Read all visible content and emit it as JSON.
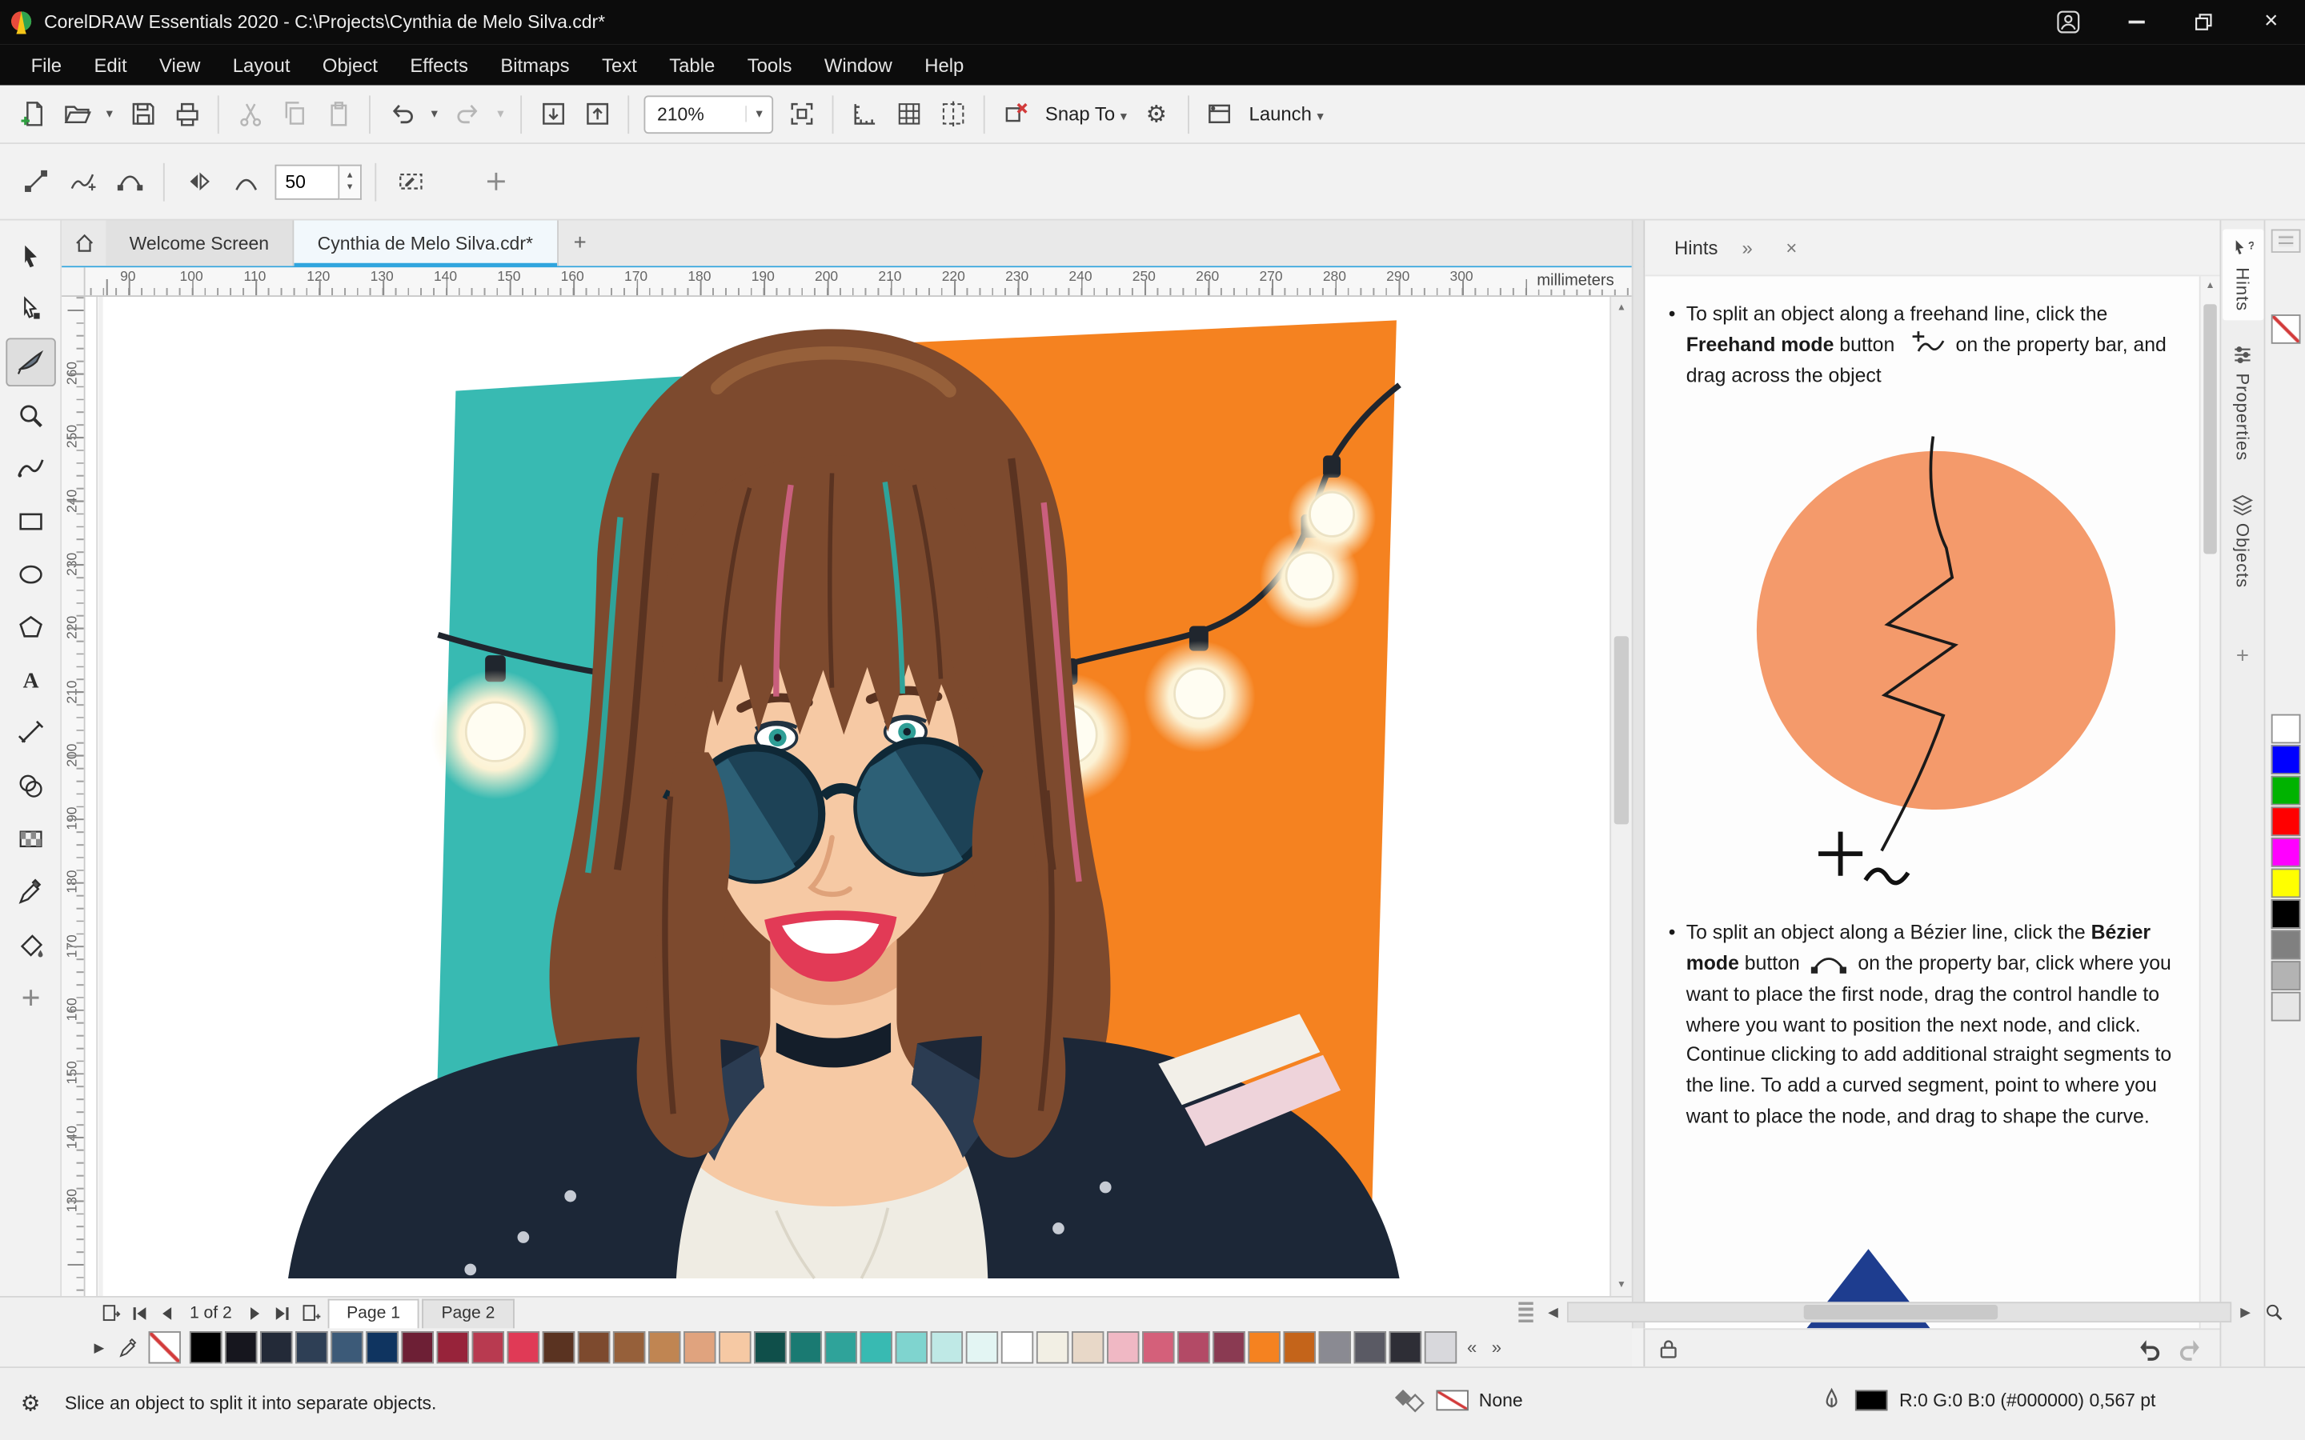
{
  "titlebar": {
    "title": "CorelDRAW Essentials 2020 - C:\\Projects\\Cynthia de Melo Silva.cdr*"
  },
  "menubar": {
    "items": [
      "File",
      "Edit",
      "View",
      "Layout",
      "Object",
      "Effects",
      "Bitmaps",
      "Text",
      "Table",
      "Tools",
      "Window",
      "Help"
    ]
  },
  "toolbar": {
    "zoom_level": "210%",
    "snap_to": "Snap To",
    "launch": "Launch"
  },
  "property_bar": {
    "smoothing_value": "50"
  },
  "document_tabs": {
    "tabs": [
      "Welcome Screen",
      "Cynthia de Melo Silva.cdr*"
    ]
  },
  "rulers": {
    "unit_label": "millimeters",
    "h_ticks": [
      "90",
      "100",
      "110",
      "120",
      "130",
      "140",
      "150",
      "160",
      "170",
      "180",
      "190",
      "200",
      "210",
      "220",
      "230",
      "240",
      "250",
      "260",
      "270",
      "280",
      "290",
      "300"
    ],
    "v_ticks": [
      "260",
      "250",
      "240",
      "230",
      "220",
      "210",
      "200",
      "190",
      "180",
      "170",
      "160",
      "150",
      "140",
      "130"
    ]
  },
  "hints": {
    "title": "Hints",
    "p1": {
      "before": "To split an object along a freehand line, click the",
      "bold": "Freehand mode",
      "mid": "button",
      "after": "on the property bar, and drag across the object"
    },
    "p2": {
      "before": "To split an object along a Bézier line, click the",
      "bold": "Bézier mode",
      "mid": "button",
      "after": "on the property bar,",
      "body": "click where you want to place the first node, drag the control handle to where you want to position the next node, and click. Continue clicking to add additional straight segments to the line. To add a curved segment, point to where you want to place the node, and drag to shape the curve."
    }
  },
  "docker_tabs": [
    "Hints",
    "Properties",
    "Objects"
  ],
  "navigator": {
    "page_indicator": "1 of 2",
    "page_tabs": [
      "Page 1",
      "Page 2"
    ]
  },
  "status_bar": {
    "message": "Slice an object to split it into separate objects.",
    "fill_none_label": "None",
    "outline_info": "R:0 G:0 B:0 (#000000)  0,567 pt"
  },
  "palettes": {
    "vertical": [
      "#ffffff",
      "#0000ff",
      "#00b300",
      "#ff0000",
      "#ff00ff",
      "#ffff00",
      "#000000",
      "#808080",
      "#b3b3b3",
      "#e6e6e6"
    ],
    "document": [
      "#000000",
      "#16161e",
      "#232a38",
      "#2e3f55",
      "#3c5a78",
      "#0f3460",
      "#6d1f35",
      "#97233a",
      "#b83a50",
      "#e03a56",
      "#5a3321",
      "#7d4a2e",
      "#96603a",
      "#c08552",
      "#e0a37e",
      "#f6c9a4",
      "#0f4f4a",
      "#1a7a72",
      "#2fa39a",
      "#38bab2",
      "#7fd4cf",
      "#bfe9e6",
      "#e3f5f3",
      "#ffffff",
      "#f2efe4",
      "#e8d8c8",
      "#f0b8c4",
      "#d4607a",
      "#b34a66",
      "#8a3a52",
      "#f58220",
      "#c4641a",
      "#8a8a92",
      "#5a5a64",
      "#2e2e36",
      "#d8d8dc"
    ]
  },
  "accent_colors": {
    "tab_accent": "#31a5de",
    "art_teal": "#38bab2",
    "art_orange": "#f58220",
    "hint_circle": "#f49a6b"
  }
}
